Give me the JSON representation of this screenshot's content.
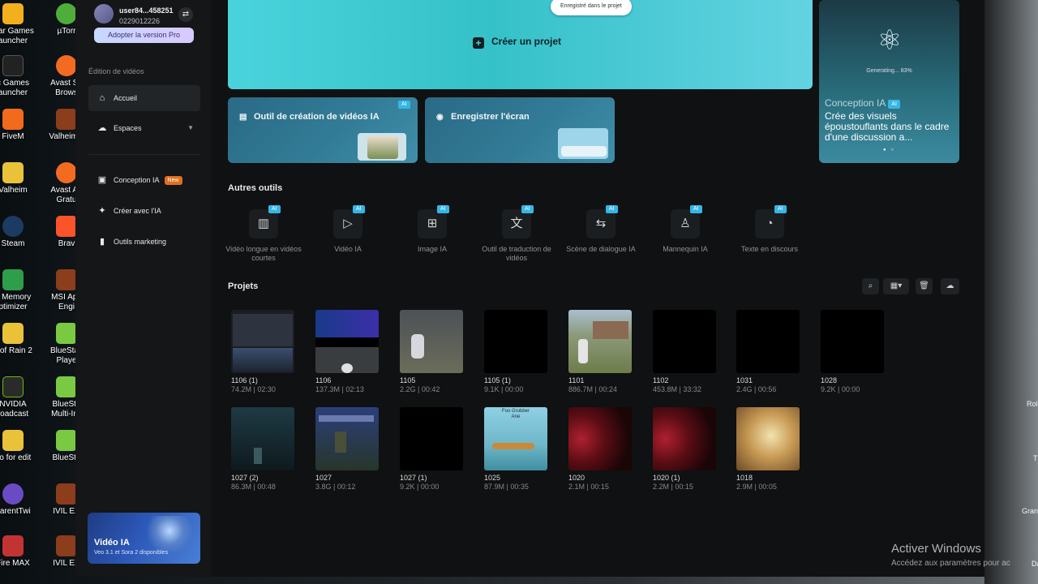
{
  "desktop": {
    "icons": [
      {
        "label": "star Games\nauncher"
      },
      {
        "label": "µTorr"
      },
      {
        "label": "c Games\nauncher"
      },
      {
        "label": "Avast Se\nBrows"
      },
      {
        "label": "FiveM"
      },
      {
        "label": "Valheim v"
      },
      {
        "label": "Valheim"
      },
      {
        "label": "Avast An\nGratu"
      },
      {
        "label": "Steam"
      },
      {
        "label": "Brav"
      },
      {
        "label": "e Memory\nptimizer"
      },
      {
        "label": "MSI App\nEngi"
      },
      {
        "label": "c of Rain 2"
      },
      {
        "label": "BlueStac\nPlaye"
      },
      {
        "label": "NVIDIA\nroadcast"
      },
      {
        "label": "BlueSta\nMulti-Ins"
      },
      {
        "label": "eo for edit"
      },
      {
        "label": "BlueSta"
      },
      {
        "label": "parentTwi"
      },
      {
        "label": "IVIL EX"
      },
      {
        "label": "Fire MAX"
      },
      {
        "label": "IVIL EX"
      }
    ],
    "right_labels": [
      "Rol",
      "T",
      "Gran",
      "Da"
    ],
    "activation": {
      "title": "Activer Windows",
      "subtitle": "Accédez aux paramètres pour ac"
    }
  },
  "sidebar": {
    "user": {
      "name": "user84...458251",
      "id": "0229012226"
    },
    "pro_button": "Adopter la version Pro",
    "section_label": "Édition de vidéos",
    "nav": [
      {
        "label": "Accueil",
        "icon": "home-icon"
      },
      {
        "label": "Espaces",
        "icon": "cloud-icon"
      },
      {
        "label": "Conception IA",
        "icon": "image-icon",
        "badge": "New"
      },
      {
        "label": "Créer avec l'IA",
        "icon": "sparkle-icon"
      },
      {
        "label": "Outils marketing",
        "icon": "bag-icon"
      }
    ],
    "promo": {
      "title": "Vidéo IA",
      "subtitle": "Veo 3.1 et Sora 2 disponibles"
    }
  },
  "hero": {
    "tooltip": "Enregistré dans le projet",
    "create_label": "Créer un projet"
  },
  "cards": [
    {
      "label": "Outil de création de vidéos IA",
      "badge": "AI"
    },
    {
      "label": "Enregistrer l'écran"
    }
  ],
  "concept": {
    "generating": "Generating... 83%",
    "title": "Conception IA",
    "badge": "AI",
    "description": "Crée des visuels époustouflants dans le cadre d'une discussion a..."
  },
  "tools": {
    "heading": "Autres outils",
    "items": [
      {
        "label": "Vidéo longue en vidéos courtes",
        "badge": "AI",
        "icon": "film-icon"
      },
      {
        "label": "Vidéo IA",
        "badge": "AI",
        "icon": "video-play-icon"
      },
      {
        "label": "Image IA",
        "badge": "AI",
        "icon": "image-plus-icon"
      },
      {
        "label": "Outil de traduction de vidéos",
        "badge": "AI",
        "icon": "translate-icon"
      },
      {
        "label": "Scène de dialogue IA",
        "badge": "AI",
        "icon": "dialogue-icon"
      },
      {
        "label": "Mannequin IA",
        "badge": "AI",
        "icon": "shirt-icon"
      },
      {
        "label": "Texte en discours",
        "badge": "AI",
        "icon": "speech-icon"
      }
    ]
  },
  "projects": {
    "heading": "Projets",
    "toolbar": [
      "search-icon",
      "grid-view-icon",
      "trash-icon",
      "cloud-off-icon"
    ],
    "items": [
      {
        "name": "1106 (1)",
        "meta": "74.2M | 02:30"
      },
      {
        "name": "1106",
        "meta": "137.3M | 02:13"
      },
      {
        "name": "1105",
        "meta": "2.2G | 00:42"
      },
      {
        "name": "1105 (1)",
        "meta": "9.1K | 00:00"
      },
      {
        "name": "1101",
        "meta": "886.7M | 00:24"
      },
      {
        "name": "1102",
        "meta": "453.8M | 33:32"
      },
      {
        "name": "1031",
        "meta": "2.4G | 00:56"
      },
      {
        "name": "1028",
        "meta": "9.2K | 00:00"
      },
      {
        "name": "1027 (2)",
        "meta": "86.3M | 00:48"
      },
      {
        "name": "1027",
        "meta": "3.8G | 00:12"
      },
      {
        "name": "1027 (1)",
        "meta": "9.2K | 00:00"
      },
      {
        "name": "1025",
        "meta": "87.9M | 00:35"
      },
      {
        "name": "1020",
        "meta": "2.1M | 00:15"
      },
      {
        "name": "1020 (1)",
        "meta": "2.2M | 00:15"
      },
      {
        "name": "1018",
        "meta": "2.9M | 00:05"
      }
    ],
    "thumb_text": {
      "line1": "Foo Grubber",
      "line2": "Ane"
    }
  }
}
